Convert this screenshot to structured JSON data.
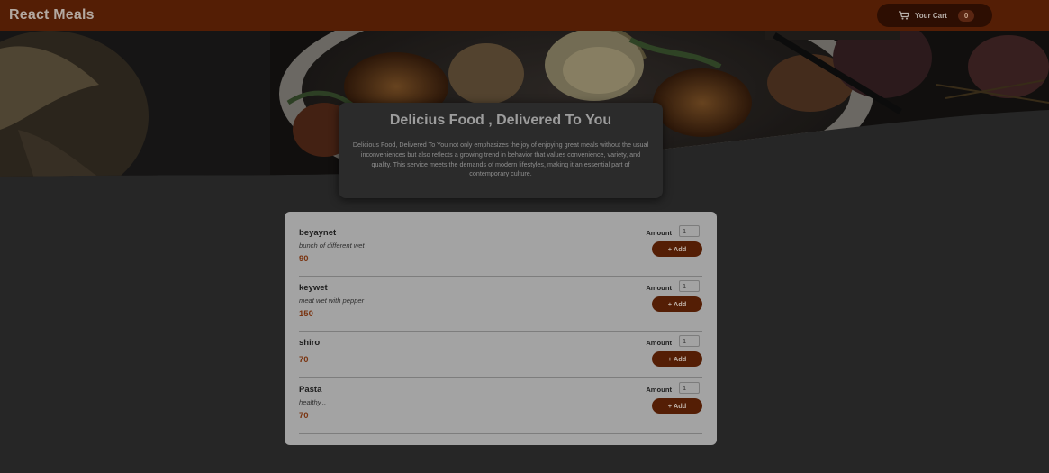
{
  "header": {
    "title": "React Meals",
    "cart_label": "Your Cart",
    "cart_count": "0",
    "cart_icon": "cart-icon"
  },
  "summary": {
    "title": "Delicius Food , Delivered To You",
    "text": "Delicious Food, Delivered To You not only emphasizes the joy of enjoying great meals without the usual inconveniences but also reflects a growing trend in behavior that values convenience, variety, and quality. This service meets the demands of modern lifestyles, making it an essential part of contemporary culture."
  },
  "meals": [
    {
      "name": "beyaynet",
      "description": "bunch of different wet",
      "price": "90",
      "amount_label": "Amount",
      "amount": "1",
      "add_label": "+ Add"
    },
    {
      "name": "keywet",
      "description": "meat wet with pepper",
      "price": "150",
      "amount_label": "Amount",
      "amount": "1",
      "add_label": "+ Add"
    },
    {
      "name": "shiro",
      "description": "",
      "price": "70",
      "amount_label": "Amount",
      "amount": "1",
      "add_label": "+ Add"
    },
    {
      "name": "Pasta",
      "description": "healthy...",
      "price": "70",
      "amount_label": "Amount",
      "amount": "1",
      "add_label": "+ Add"
    }
  ],
  "colors": {
    "header_bg": "#541e05",
    "page_bg": "#262626",
    "card_bg": "#a3a3a3",
    "price": "#7a3410",
    "button_bg": "#541e05"
  }
}
